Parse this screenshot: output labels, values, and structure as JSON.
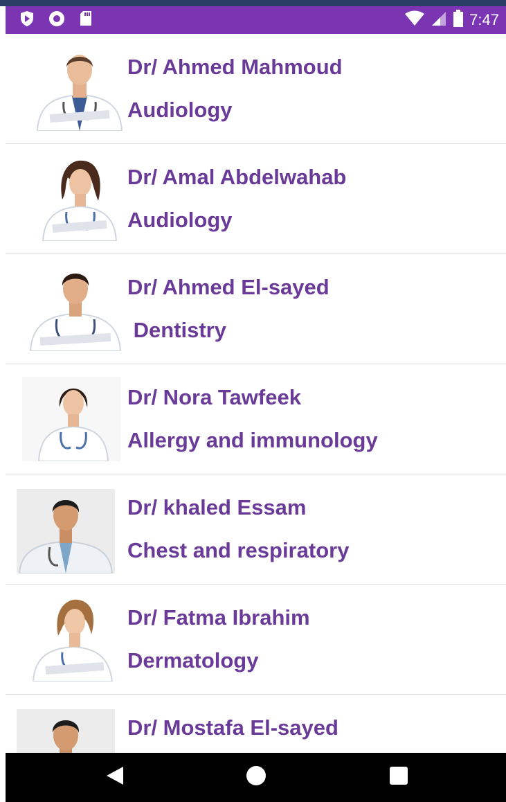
{
  "status_bar": {
    "time": "7:47",
    "icons": [
      "shield-icon",
      "circle-icon",
      "sd-card-icon",
      "wifi-icon",
      "signal-icon",
      "battery-icon"
    ],
    "color": "#7b35b3"
  },
  "accent_text_color": "#6a3a99",
  "doctors": [
    {
      "name": "Dr/ Ahmed Mahmoud",
      "specialty": "Audiology",
      "photo": "male-doctor-photo"
    },
    {
      "name": "Dr/ Amal Abdelwahab",
      "specialty": "Audiology",
      "photo": "female-doctor-photo"
    },
    {
      "name": "Dr/ Ahmed El-sayed",
      "specialty": " Dentistry",
      "photo": "male-doctor-photo"
    },
    {
      "name": "Dr/ Nora Tawfeek",
      "specialty": "Allergy and immunology",
      "photo": "female-doctor-photo"
    },
    {
      "name": "Dr/ khaled Essam",
      "specialty": "Chest and respiratory",
      "photo": "male-doctor-photo"
    },
    {
      "name": "Dr/ Fatma Ibrahim",
      "specialty": "Dermatology",
      "photo": "female-doctor-photo"
    },
    {
      "name": "Dr/ Mostafa El-sayed",
      "specialty": "",
      "photo": "male-doctor-photo"
    }
  ],
  "nav_bar": {
    "icons": [
      "back-icon",
      "home-icon",
      "recents-icon"
    ]
  }
}
